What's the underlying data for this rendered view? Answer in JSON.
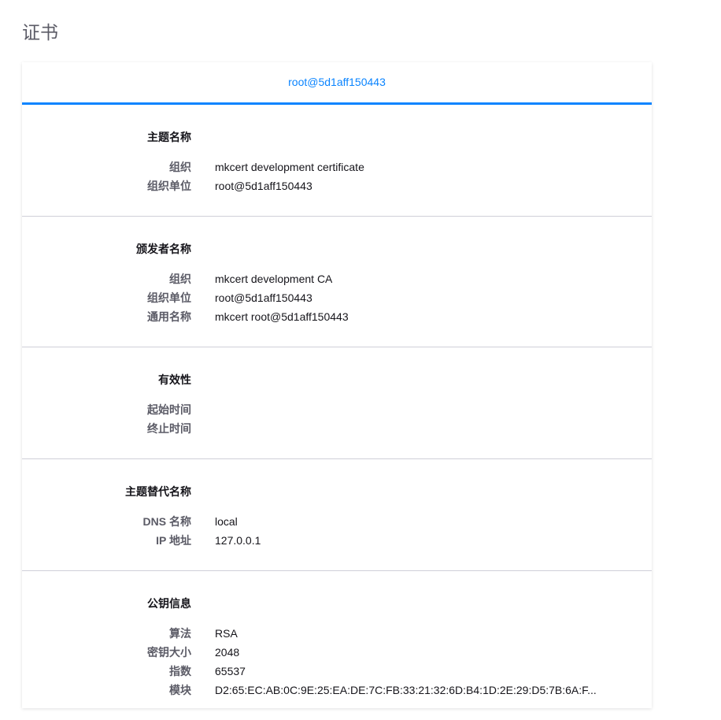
{
  "page": {
    "title": "证书"
  },
  "tabs": [
    {
      "label": "root@5d1aff150443",
      "selected": true
    }
  ],
  "accent_color": "#0a84ff",
  "sections": {
    "subject": {
      "title": "主题名称",
      "rows": [
        {
          "key": "组织",
          "value": "mkcert development certificate"
        },
        {
          "key": "组织单位",
          "value": "root@5d1aff150443"
        }
      ]
    },
    "issuer": {
      "title": "颁发者名称",
      "rows": [
        {
          "key": "组织",
          "value": "mkcert development CA"
        },
        {
          "key": "组织单位",
          "value": "root@5d1aff150443"
        },
        {
          "key": "通用名称",
          "value": "mkcert root@5d1aff150443"
        }
      ]
    },
    "validity": {
      "title": "有效性",
      "rows": [
        {
          "key": "起始时间",
          "value": ""
        },
        {
          "key": "终止时间",
          "value": ""
        }
      ]
    },
    "san": {
      "title": "主题替代名称",
      "rows": [
        {
          "key": "DNS 名称",
          "value": "local"
        },
        {
          "key": "IP 地址",
          "value": "127.0.0.1"
        }
      ]
    },
    "public_key": {
      "title": "公钥信息",
      "rows": [
        {
          "key": "算法",
          "value": "RSA"
        },
        {
          "key": "密钥大小",
          "value": "2048"
        },
        {
          "key": "指数",
          "value": "65537"
        },
        {
          "key": "模块",
          "value": "D2:65:EC:AB:0C:9E:25:EA:DE:7C:FB:33:21:32:6D:B4:1D:2E:29:D5:7B:6A:F..."
        }
      ]
    }
  }
}
